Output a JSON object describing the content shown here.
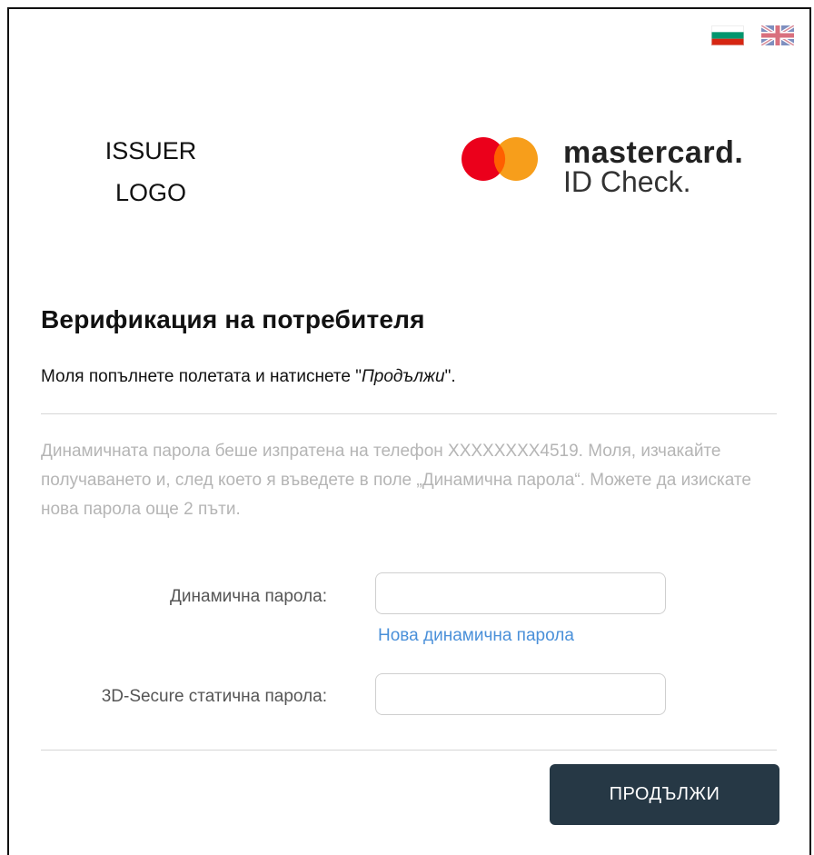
{
  "languages": [
    {
      "code": "bg",
      "icon": "bulgarian-flag-icon"
    },
    {
      "code": "en",
      "icon": "uk-flag-icon"
    }
  ],
  "issuer_logo": {
    "line1": "ISSUER",
    "line2": "LOGO"
  },
  "brand": {
    "name": "mastercard.",
    "product": "ID Check.",
    "colors": {
      "red": "#eb001b",
      "orange": "#f79e1b",
      "overlap": "#ff5f00"
    }
  },
  "form": {
    "title": "Верификация на потребителя",
    "instruction_prefix": "Моля попълнете полетата и натиснете \"",
    "instruction_em": "Продължи",
    "instruction_suffix": "\".",
    "info_text": "Динамичната парола беше изпратена на телефон XXXXXXXX4519. Моля, изчакайте получаването и, след което я въведете в поле „Динамична парола“. Можете да изискате нова парола още 2 пъти.",
    "dynamic_password_label": "Динамична парола:",
    "dynamic_password_value": "",
    "new_password_link": "Нова динамична парола",
    "static_password_label": "3D-Secure статична парола:",
    "static_password_value": "",
    "continue_label": "ПРОДЪЛЖИ"
  },
  "theme": {
    "button_bg": "#263845",
    "link_color": "#4a90d9",
    "info_color": "#b5b5b5"
  }
}
